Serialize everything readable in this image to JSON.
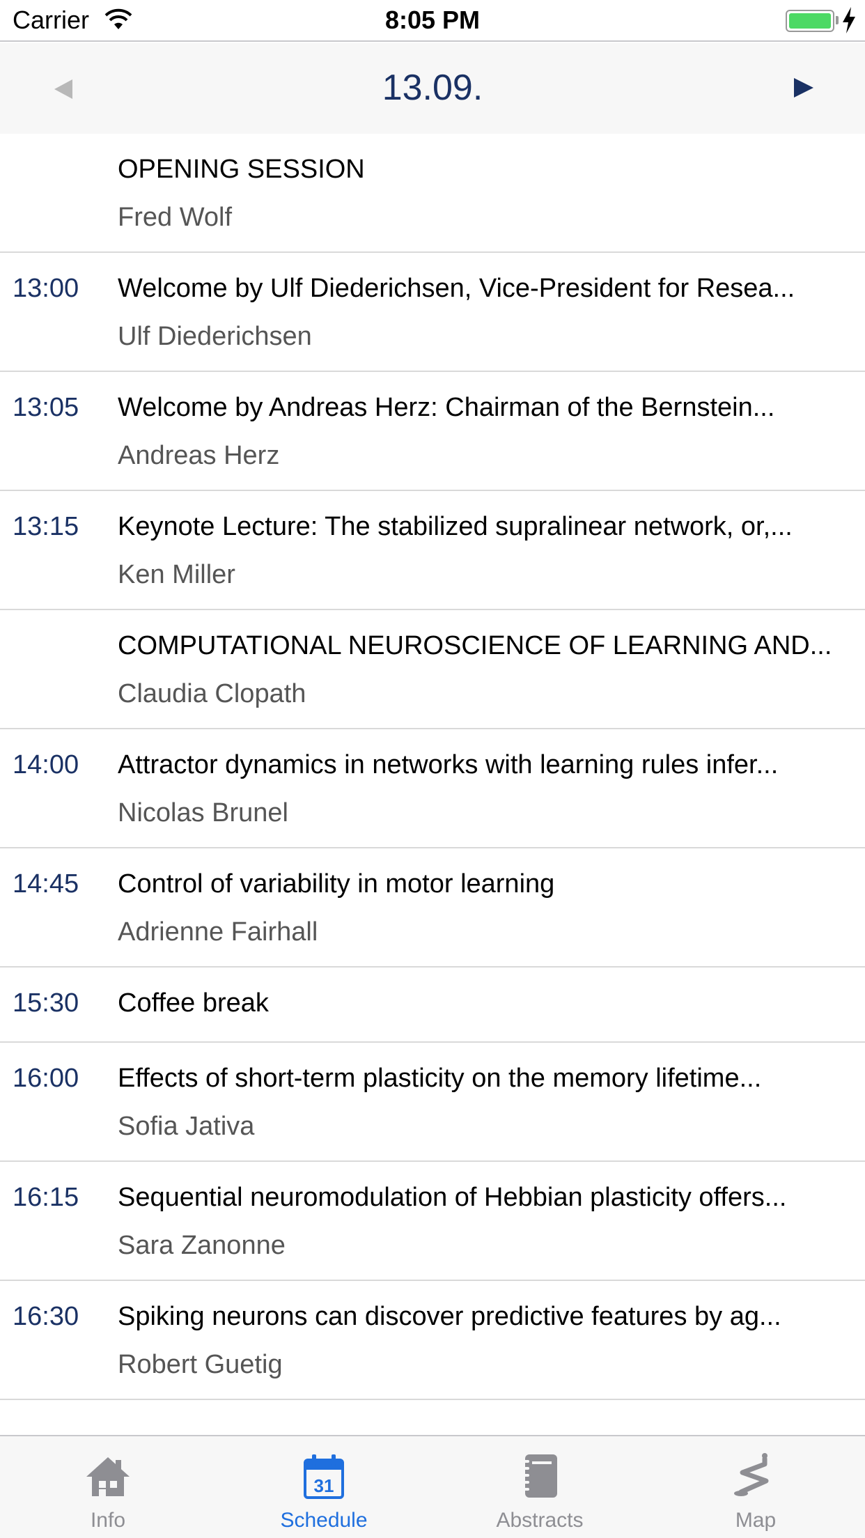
{
  "status_bar": {
    "carrier": "Carrier",
    "time": "8:05 PM",
    "battery_color": "#4cd964"
  },
  "date_nav": {
    "date": "13.09.",
    "prev_icon": "triangle-left-icon",
    "next_icon": "triangle-right-icon",
    "accent_color": "#1a3164"
  },
  "sessions": [
    {
      "time": "",
      "title": "OPENING SESSION",
      "speaker": "Fred Wolf"
    },
    {
      "time": "13:00",
      "title": "Welcome by Ulf Diederichsen, Vice-President for Resea...",
      "speaker": "Ulf Diederichsen"
    },
    {
      "time": "13:05",
      "title": "Welcome by Andreas Herz: Chairman of the Bernstein...",
      "speaker": "Andreas Herz"
    },
    {
      "time": "13:15",
      "title": "Keynote Lecture: The stabilized supralinear network, or,...",
      "speaker": "Ken Miller"
    },
    {
      "time": "",
      "title": "COMPUTATIONAL NEUROSCIENCE OF LEARNING AND...",
      "speaker": "Claudia Clopath"
    },
    {
      "time": "14:00",
      "title": "Attractor dynamics in networks with learning rules infer...",
      "speaker": "Nicolas Brunel"
    },
    {
      "time": "14:45",
      "title": "Control of variability in motor learning",
      "speaker": "Adrienne Fairhall"
    },
    {
      "time": "15:30",
      "title": "Coffee break",
      "speaker": ""
    },
    {
      "time": "16:00",
      "title": "Effects of short-term plasticity on the memory lifetime...",
      "speaker": "Sofia Jativa"
    },
    {
      "time": "16:15",
      "title": "Sequential neuromodulation of Hebbian plasticity offers...",
      "speaker": "Sara Zanonne"
    },
    {
      "time": "16:30",
      "title": "Spiking neurons can discover predictive features by ag...",
      "speaker": "Robert Guetig"
    }
  ],
  "tab_bar": {
    "tabs": [
      {
        "label": "Info",
        "icon": "house-icon",
        "active": false
      },
      {
        "label": "Schedule",
        "icon": "calendar-icon",
        "active": true,
        "calendar_day": "31"
      },
      {
        "label": "Abstracts",
        "icon": "notebook-icon",
        "active": false
      },
      {
        "label": "Map",
        "icon": "path-map-icon",
        "active": false
      }
    ],
    "active_color": "#1f6fde",
    "inactive_color": "#8e8e93"
  }
}
